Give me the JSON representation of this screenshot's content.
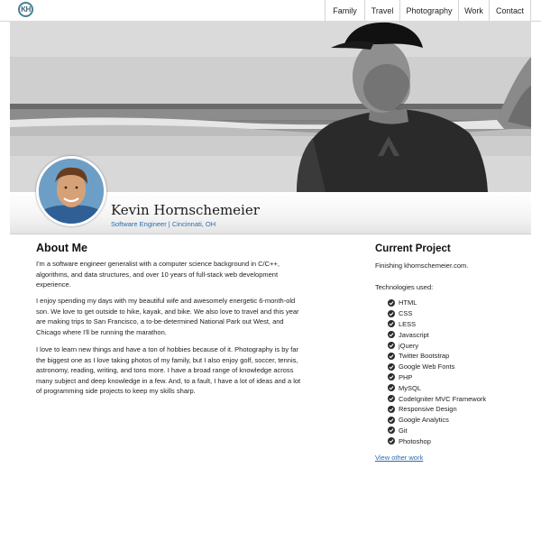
{
  "logo": {
    "text": "KH"
  },
  "nav": {
    "items": [
      {
        "label": "Family"
      },
      {
        "label": "Travel"
      },
      {
        "label": "Photography"
      },
      {
        "label": "Work"
      },
      {
        "label": "Contact"
      }
    ]
  },
  "profile": {
    "name": "Kevin Hornschemeier",
    "title_link": "Software Engineer",
    "separator": " | ",
    "location_link": "Cincinnati, OH"
  },
  "about": {
    "heading": "About Me",
    "paragraphs": [
      "I'm a software engineer generalist with a computer science background in C/C++, algorithms, and data structures, and over 10 years of full-stack web development experience.",
      "I enjoy spending my days with my beautiful wife and awesomely energetic 6-month-old son. We love to get outside to hike, kayak, and bike. We also love to travel and this year are making trips to San Francisco, a to-be-determined National Park out West, and Chicago where I'll be running the marathon.",
      "I love to learn new things and have a ton of hobbies because of it. Photography is by far the biggest one as I love taking photos of my family, but I also enjoy golf, soccer, tennis, astronomy, reading, writing, and tons more. I have a broad range of knowledge across many subject and deep knowledge in a few. And, to a fault, I have a lot of ideas and a lot of programming side projects to keep my skills sharp."
    ]
  },
  "project": {
    "heading": "Current Project",
    "description": "Finishing khornschemeier.com.",
    "tech_label": "Technologies used:",
    "technologies": [
      "HTML",
      "CSS",
      "LESS",
      "Javascript",
      "jQuery",
      "Twitter Bootstrap",
      "Google Web Fonts",
      "PHP",
      "MySQL",
      "CodeIgniter MVC Framework",
      "Responsive Design",
      "Google Analytics",
      "Git",
      "Photoshop"
    ],
    "view_other": "View other work"
  },
  "colors": {
    "link": "#2c6cae",
    "logo_ring": "#4a7f95",
    "border": "#d4d4d4"
  },
  "icons": {
    "list_bullet": "check-circle-icon"
  }
}
